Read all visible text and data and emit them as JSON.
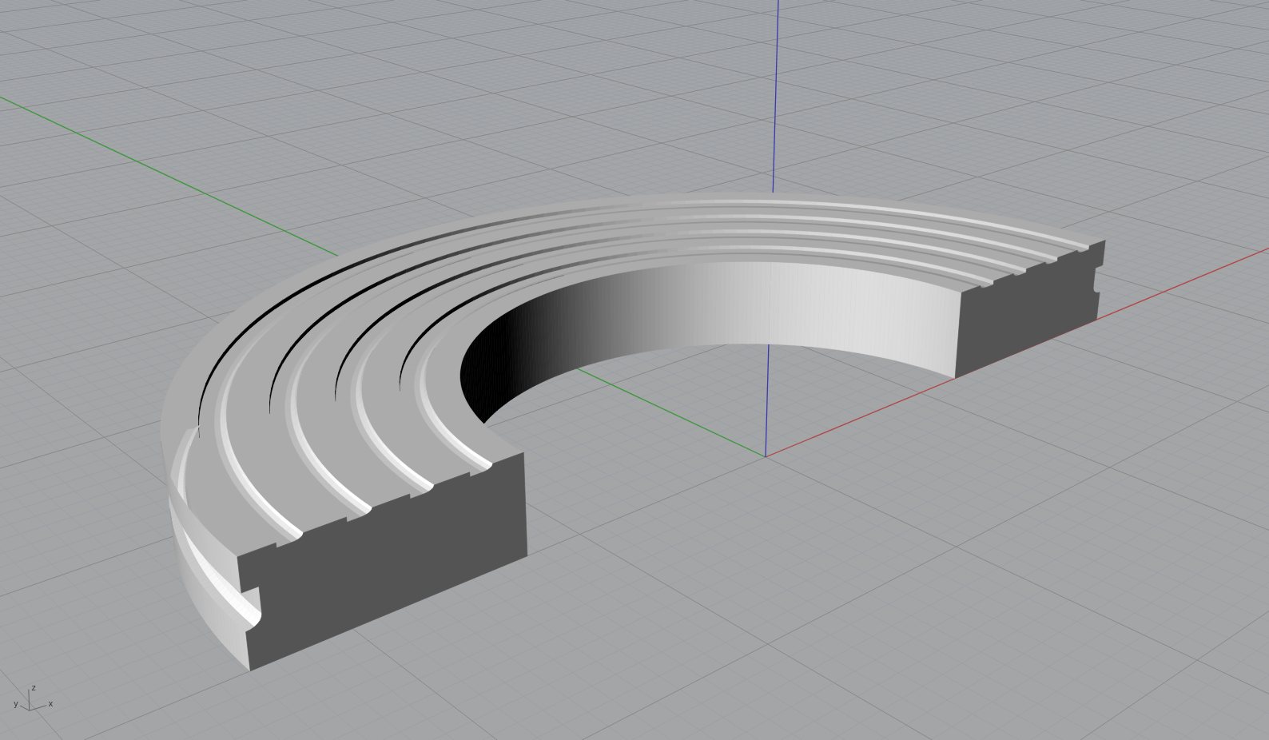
{
  "world_axes": [
    {
      "kind": "x",
      "color": "#b44848"
    },
    {
      "kind": "y",
      "color": "#3c9a3c"
    },
    {
      "kind": "z",
      "color": "#3a3aae"
    }
  ],
  "axis_gizmo": {
    "labels": [
      {
        "kind": "z",
        "text": "z"
      },
      {
        "kind": "y",
        "text": "y"
      },
      {
        "kind": "x",
        "text": "x"
      }
    ]
  }
}
